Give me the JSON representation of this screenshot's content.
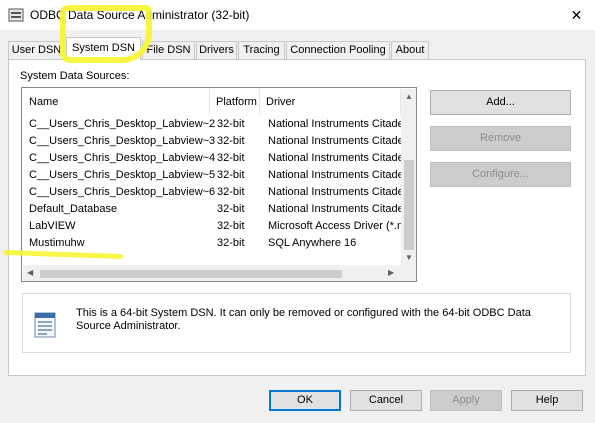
{
  "window": {
    "title": "ODBC Data Source Administrator (32-bit)"
  },
  "tabs": [
    "User DSN",
    "System DSN",
    "File DSN",
    "Drivers",
    "Tracing",
    "Connection Pooling",
    "About"
  ],
  "active_tab": "System DSN",
  "section_label": "System Data Sources:",
  "table": {
    "columns": [
      "Name",
      "Platform",
      "Driver"
    ],
    "rows": [
      [
        "C__Users_Chris_Desktop_Labview~2",
        "32-bit",
        "National Instruments Citadel"
      ],
      [
        "C__Users_Chris_Desktop_Labview~3",
        "32-bit",
        "National Instruments Citadel"
      ],
      [
        "C__Users_Chris_Desktop_Labview~4",
        "32-bit",
        "National Instruments Citadel"
      ],
      [
        "C__Users_Chris_Desktop_Labview~5",
        "32-bit",
        "National Instruments Citadel"
      ],
      [
        "C__Users_Chris_Desktop_Labview~6",
        "32-bit",
        "National Instruments Citadel"
      ],
      [
        "Default_Database",
        "32-bit",
        "National Instruments Citadel"
      ],
      [
        "LabVIEW",
        "32-bit",
        "Microsoft Access Driver (*.mdb)"
      ],
      [
        "Mustimuhw",
        "32-bit",
        "SQL Anywhere 16"
      ]
    ]
  },
  "side_buttons": {
    "add": "Add...",
    "remove": "Remove",
    "configure": "Configure..."
  },
  "info_text": "This is a 64-bit System DSN. It can only be removed or configured with the 64-bit ODBC Data Source Administrator.",
  "footer_buttons": {
    "ok": "OK",
    "cancel": "Cancel",
    "apply": "Apply",
    "help": "Help"
  },
  "icons": {
    "app": "odbc-app-icon",
    "close": "close-icon",
    "info": "data-source-icon"
  },
  "colors": {
    "highlight": "#f7f535",
    "default_button_border": "#0078d7"
  }
}
